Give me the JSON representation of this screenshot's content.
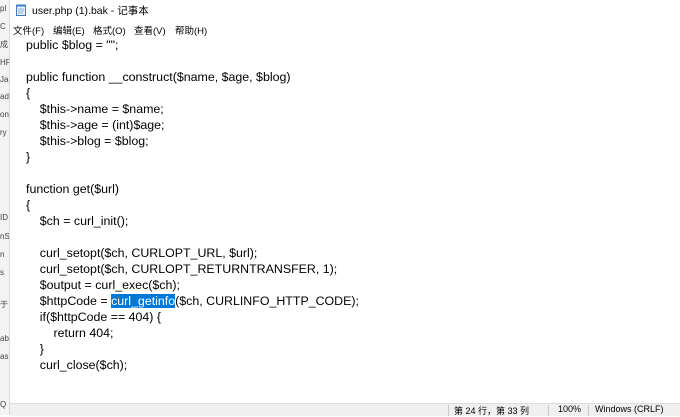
{
  "window": {
    "title": "user.php (1).bak - 记事本"
  },
  "menu": [
    {
      "label": "文件(F)"
    },
    {
      "label": "编辑(E)"
    },
    {
      "label": "格式(O)"
    },
    {
      "label": "查看(V)"
    },
    {
      "label": "帮助(H)"
    }
  ],
  "left_fragments": [
    "pl",
    "C",
    "成",
    "HF",
    "Ja",
    "ad",
    "on",
    "ry",
    "ID",
    "nS",
    "n",
    "s",
    "于",
    "ab",
    "as",
    "Q"
  ],
  "editor": {
    "lines": [
      "public $blog = \"\";",
      "",
      "public function __construct($name, $age, $blog)",
      "{",
      "    $this->name = $name;",
      "    $this->age = (int)$age;",
      "    $this->blog = $blog;",
      "}",
      "",
      "function get($url)",
      "{",
      "    $ch = curl_init();",
      "",
      "    curl_setopt($ch, CURLOPT_URL, $url);",
      "    curl_setopt($ch, CURLOPT_RETURNTRANSFER, 1);",
      "    $output = curl_exec($ch);",
      "    $httpCode = ",
      "    if($httpCode == 404) {",
      "        return 404;",
      "    }",
      "    curl_close($ch);"
    ],
    "selected_line": {
      "prefix": "    $httpCode = ",
      "selected": "curl_getinfo",
      "suffix": "($ch, CURLINFO_HTTP_CODE);"
    }
  },
  "status": {
    "position": "第 24 行，第 33 列",
    "zoom": "100%",
    "line_ending": "Windows (CRLF)"
  },
  "colors": {
    "selection": "#0078d7",
    "statusbar": "#f0f0f0"
  }
}
